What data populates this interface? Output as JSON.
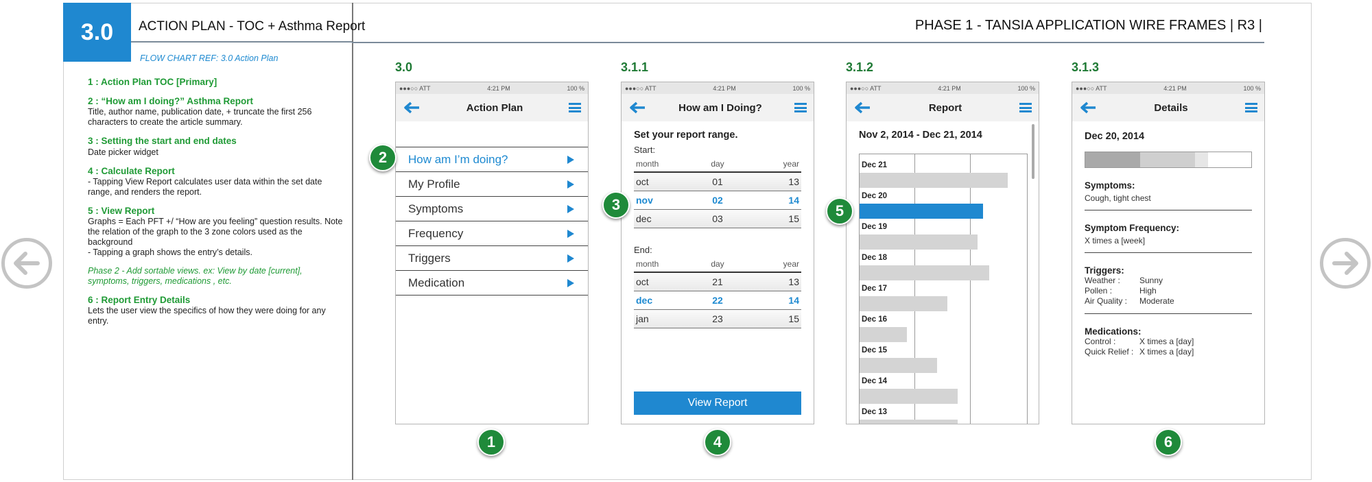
{
  "header": {
    "section_number": "3.0",
    "section_title": "ACTION PLAN - TOC + Asthma Report",
    "flow_ref": "FLOW CHART REF:  3.0 Action Plan",
    "phase_title": "PHASE 1 - TANSIA APPLICATION WIRE FRAMES  | R3 |"
  },
  "notes": [
    {
      "heading": "1 : Action Plan TOC [Primary]",
      "body": ""
    },
    {
      "heading": "2 : “How am I doing?” Asthma Report",
      "body": "Title, author name, publication date, + truncate the first 256 characters to create the article summary."
    },
    {
      "heading": "3 : Setting the start and end dates",
      "body": "Date picker widget"
    },
    {
      "heading": "4 : Calculate Report",
      "body": "- Tapping View Report calculates user data within the set date range, and renders the report."
    },
    {
      "heading": "5 : View Report",
      "body": "Graphs  = Each PFT +/  “How are you feeling” question results. Note the relation of the graph to the 3 zone colors used as the background\n- Tapping a graph shows the entry’s details."
    },
    {
      "heading": "Phase 2 - Add sortable views. ex: View by date [current], symptoms, triggers, medications , etc.",
      "body": ""
    },
    {
      "heading": "6 : Report Entry Details",
      "body": "Lets the user view the specifics of how they were doing for any entry."
    }
  ],
  "status_bar": {
    "carrier": "●●●○○ ATT",
    "time": "4:21 PM",
    "battery": "100 %"
  },
  "screens": {
    "s1": {
      "label": "3.0",
      "title": "Action Plan",
      "menu": [
        "How am I’m doing?",
        "My Profile",
        "Symptoms",
        "Frequency",
        "Triggers",
        "Medication"
      ]
    },
    "s2": {
      "label": "3.1.1",
      "title": "How am I Doing?",
      "heading": "Set your report range.",
      "start_label": "Start:",
      "end_label": "End:",
      "cols": [
        "month",
        "day",
        "year"
      ],
      "start_rows": [
        [
          "oct",
          "01",
          "13"
        ],
        [
          "nov",
          "02",
          "14"
        ],
        [
          "dec",
          "03",
          "15"
        ]
      ],
      "end_rows": [
        [
          "oct",
          "21",
          "13"
        ],
        [
          "dec",
          "22",
          "14"
        ],
        [
          "jan",
          "23",
          "15"
        ]
      ],
      "button": "View Report"
    },
    "s3": {
      "label": "3.1.2",
      "title": "Report",
      "range": "Nov 2, 2014 - Dec 21, 2014",
      "bars": [
        "Dec 21",
        "Dec 20",
        "Dec 19",
        "Dec 18",
        "Dec 17",
        "Dec 16",
        "Dec 15",
        "Dec 14",
        "Dec 13"
      ],
      "values": [
        0.88,
        0.73,
        0.7,
        0.77,
        0.52,
        0.28,
        0.46,
        0.58,
        0.58
      ],
      "selected": "Dec 20"
    },
    "s4": {
      "label": "3.1.3",
      "title": "Details",
      "date": "Dec 20, 2014",
      "symptoms_h": "Symptoms:",
      "symptoms_v": "Cough, tight chest",
      "freq_h": "Symptom Frequency:",
      "freq_v": "X times a [week]",
      "triggers_h": "Triggers:",
      "triggers": [
        [
          "Weather :",
          "Sunny"
        ],
        [
          "Pollen :",
          "High"
        ],
        [
          "Air Quality :",
          "Moderate"
        ]
      ],
      "meds_h": "Medications:",
      "meds": [
        [
          "Control :",
          "X times a [day]"
        ],
        [
          "Quick Relief :",
          "X times a [day]"
        ]
      ]
    }
  },
  "callouts": {
    "c1": "1",
    "c2": "2",
    "c3": "3",
    "c4": "4",
    "c5": "5",
    "c6": "6"
  },
  "colors": {
    "accent": "#1f88d0",
    "badge_green": "#1f8a3a",
    "heading_green": "#1f9a35"
  }
}
